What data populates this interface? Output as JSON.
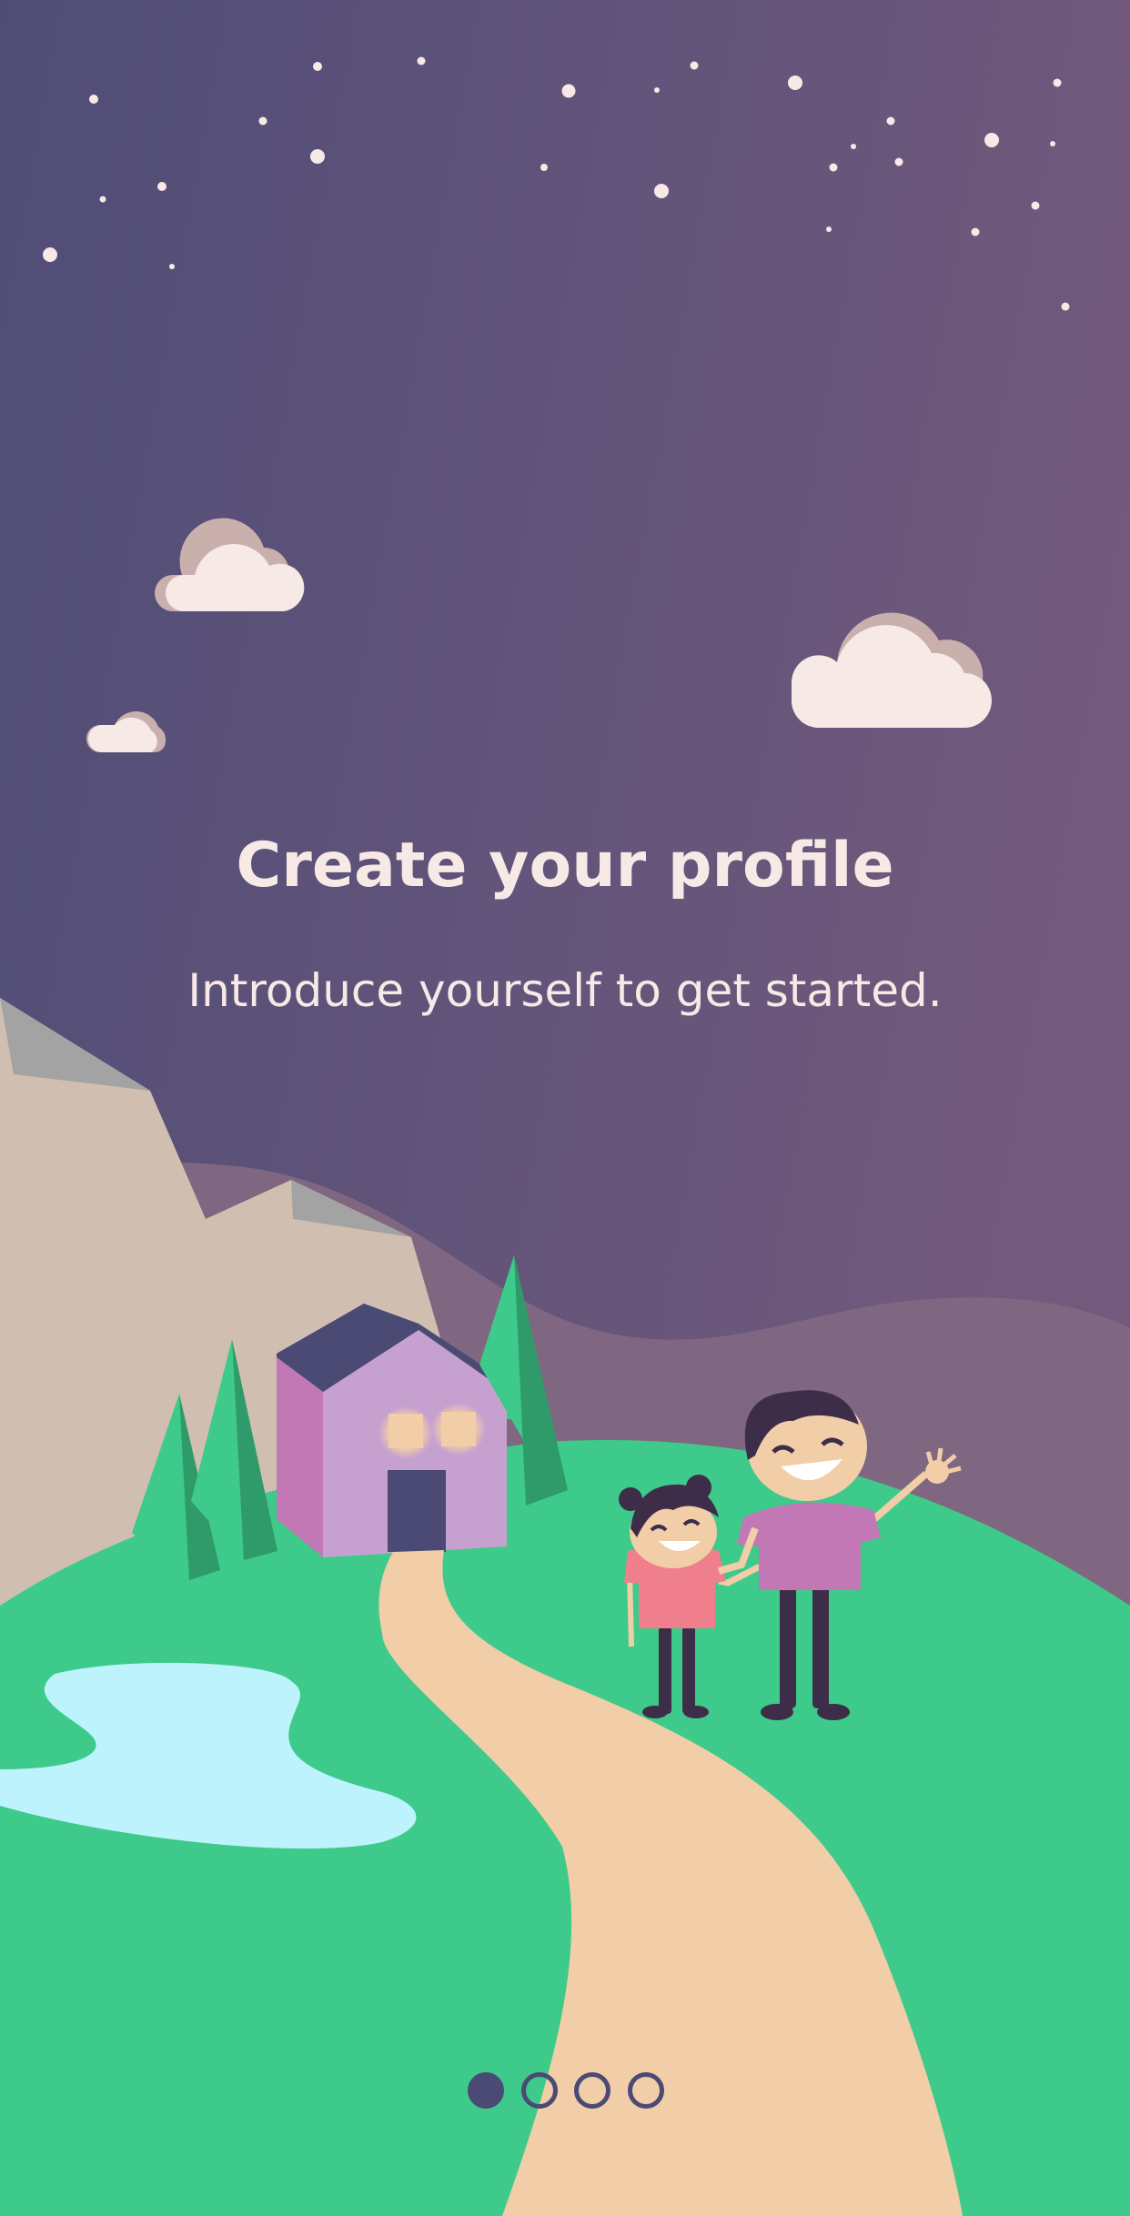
{
  "onboarding": {
    "title": "Create your profile",
    "subtitle": "Introduce yourself to get started.",
    "pager": {
      "total_pages": 4,
      "current_page": 1
    }
  },
  "colors": {
    "sky_start": "#4f4d77",
    "sky_end": "#735a7c",
    "ink": "#f7e9e6",
    "grass": "#3dca8a",
    "path": "#f1cda8",
    "water": "#bdf3fc",
    "house_wall": "#c6a1d0",
    "house_side": "#c278b4",
    "roof_and_dots": "#4a4a74",
    "tree": "#2f9a6a",
    "rock": "#d0bfb0",
    "far_hill": "#806781"
  }
}
